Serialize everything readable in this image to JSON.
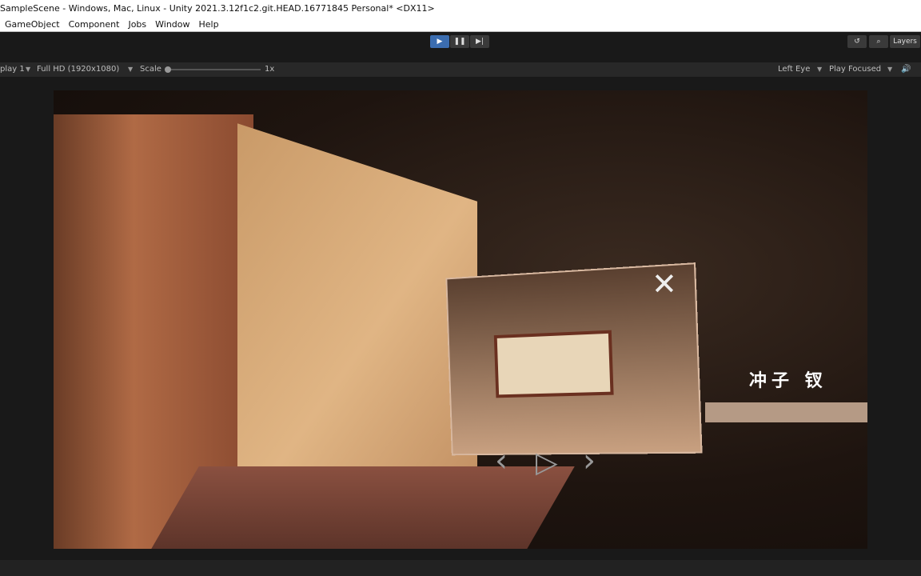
{
  "window": {
    "title": "SampleScene - Windows, Mac, Linux - Unity 2021.3.12f1c2.git.HEAD.16771845 Personal* <DX11>"
  },
  "menu": [
    "GameObject",
    "Component",
    "Jobs",
    "Window",
    "Help"
  ],
  "toolbar": {
    "play_icon": "play-icon",
    "pause_icon": "pause-icon",
    "step_icon": "step-icon",
    "history_icon": "history-icon",
    "search_icon": "search-icon",
    "layers": "Layers",
    "accent": "#3b6db0"
  },
  "gamebar": {
    "display": "play 1",
    "resolution": "Full HD (1920x1080)",
    "scale_label": "Scale",
    "scale_value": "1x",
    "eye": "Left Eye",
    "play_mode": "Play Focused"
  },
  "scene": {
    "caption": "冲子 钗"
  }
}
